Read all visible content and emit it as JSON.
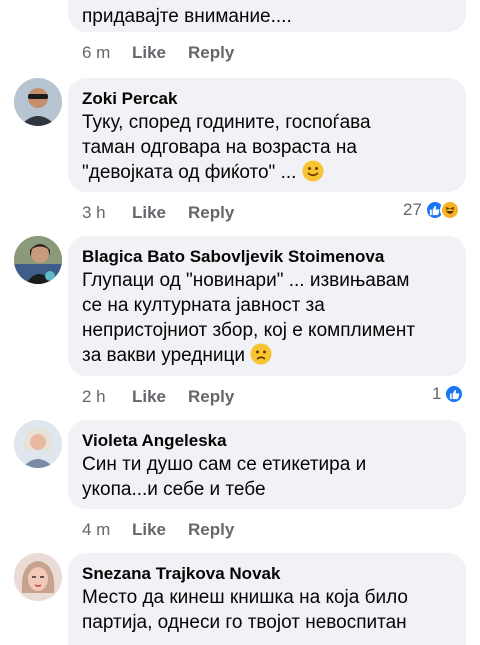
{
  "comments": [
    {
      "author": "",
      "text_line": "придавајте внимание....",
      "time": "6 m",
      "like": "Like",
      "reply": "Reply",
      "reaction_count": ""
    },
    {
      "author": "Zoki Percak",
      "text": [
        "Туку, според годините, госпоѓава",
        "таман одговара на возраста на",
        "\"девојката од фиќото\" ..."
      ],
      "time": "3 h",
      "like": "Like",
      "reply": "Reply",
      "reaction_count": "27",
      "reactions": [
        "like-icon",
        "haha-icon"
      ]
    },
    {
      "author": "Blagica Bato Sabovljevik Stoimenova",
      "text": [
        "Глупаци од \"новинари\" ... извињавам",
        "се на културната јавност за",
        "непристојниот збор, кој е комплимент",
        "за вакви уредници"
      ],
      "time": "2 h",
      "like": "Like",
      "reply": "Reply",
      "reaction_count": "1",
      "reactions": [
        "like-icon"
      ]
    },
    {
      "author": "Violeta Angeleska",
      "text": [
        "Син ти душо сам се етикетира и",
        "укопа...и себе и тебе"
      ],
      "time": "4 m",
      "like": "Like",
      "reply": "Reply"
    },
    {
      "author": "Snezana Trajkova Novak",
      "text": [
        "Место да кинеш книшка на која било",
        "партија, однеси го твојот невоспитан"
      ]
    }
  ],
  "colors": {
    "bubble": "#f0f2f5",
    "meta_text": "#65676b",
    "like_blue": "#1877f2",
    "haha_yellow": "#f7b125"
  }
}
